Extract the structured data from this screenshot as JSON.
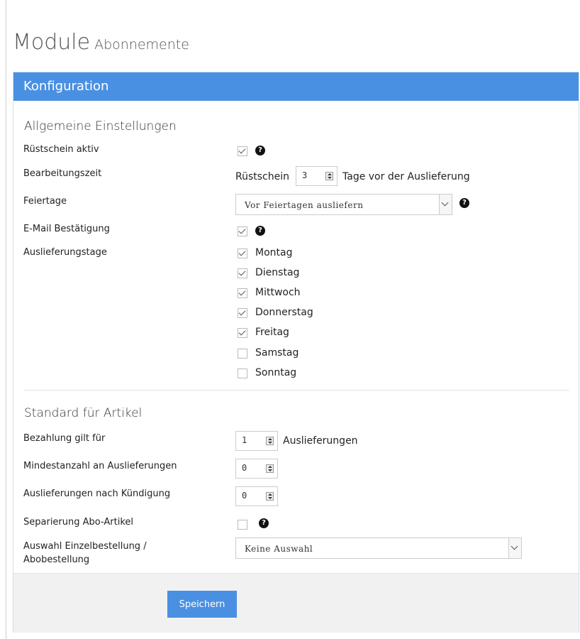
{
  "page": {
    "title": "Module",
    "subtitle": "Abonnemente"
  },
  "panel": {
    "header": "Konfiguration"
  },
  "general": {
    "section_title": "Allgemeine Einstellungen",
    "ruestschein_label": "Rüstschein aktiv",
    "ruestschein_checked": true,
    "bearbeitungszeit_label": "Bearbeitungszeit",
    "bearbeitungszeit_prefix": "Rüstschein",
    "bearbeitungszeit_value": "3",
    "bearbeitungszeit_suffix": "Tage vor der Auslieferung",
    "feiertage_label": "Feiertage",
    "feiertage_value": "Vor Feiertagen ausliefern",
    "email_label": "E-Mail Bestätigung",
    "email_checked": true,
    "auslieferungstage_label": "Auslieferungstage",
    "days": [
      {
        "label": "Montag",
        "checked": true
      },
      {
        "label": "Dienstag",
        "checked": true
      },
      {
        "label": "Mittwoch",
        "checked": true
      },
      {
        "label": "Donnerstag",
        "checked": true
      },
      {
        "label": "Freitag",
        "checked": true
      },
      {
        "label": "Samstag",
        "checked": false
      },
      {
        "label": "Sonntag",
        "checked": false
      }
    ]
  },
  "article": {
    "section_title": "Standard für Artikel",
    "bezahlung_label": "Bezahlung gilt für",
    "bezahlung_value": "1",
    "bezahlung_suffix": "Auslieferungen",
    "mindestanzahl_label": "Mindestanzahl an Auslieferungen",
    "mindestanzahl_value": "0",
    "kuendigung_label": "Auslieferungen nach Kündigung",
    "kuendigung_value": "0",
    "separierung_label": "Separierung Abo-Artikel",
    "separierung_checked": false,
    "auswahl_label_line1": "Auswahl Einzelbestellung /",
    "auswahl_label_line2": "Abobestellung",
    "auswahl_value": "Keine Auswahl"
  },
  "footer": {
    "save_label": "Speichern"
  },
  "icons": {
    "help": "question-circle-icon",
    "check": "check-icon",
    "dropdown": "chevron-down-icon"
  },
  "colors": {
    "accent": "#4a90e2",
    "header_text": "#ffffff"
  }
}
